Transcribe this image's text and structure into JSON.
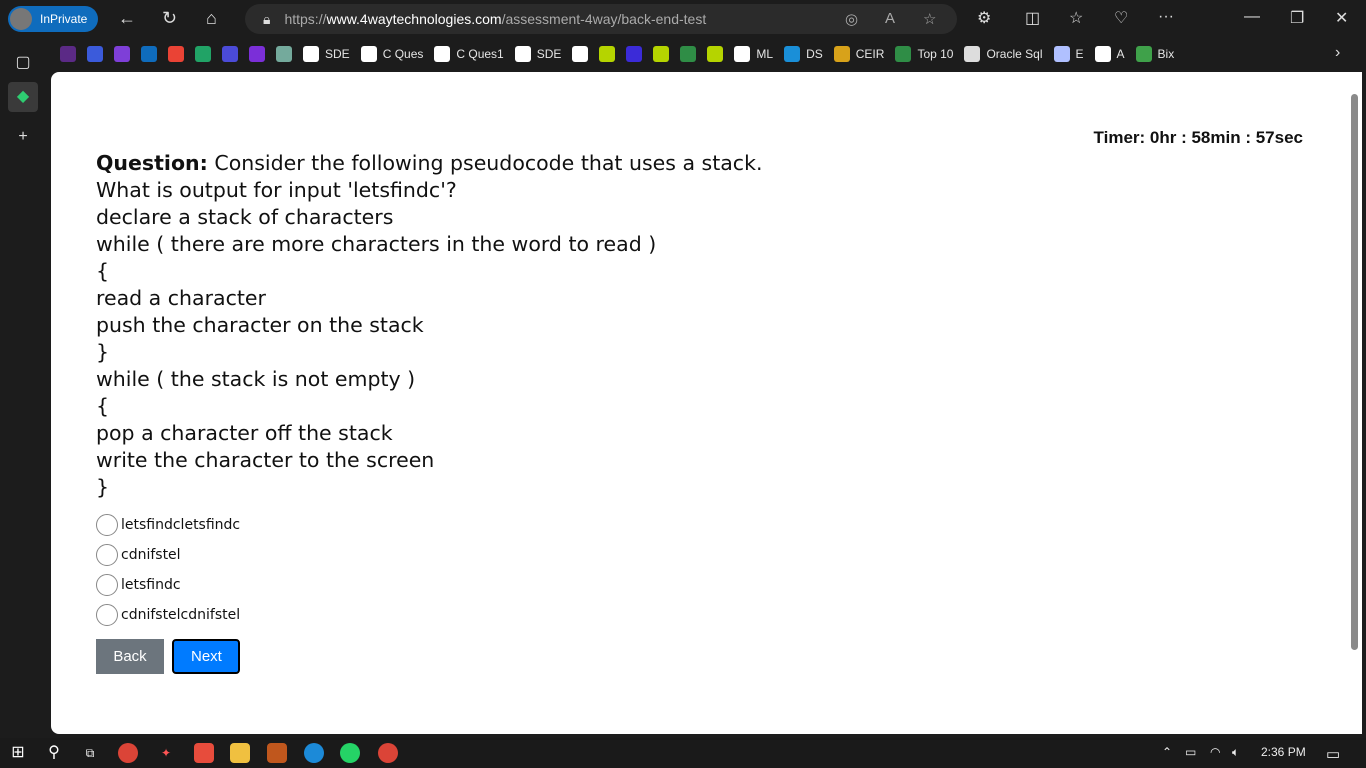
{
  "browser": {
    "profile": "InPrivate",
    "url_scheme": "https://",
    "url_domain": "www.4waytechnologies.com",
    "url_path": "/assessment-4way/back-end-test"
  },
  "bookmarks": [
    {
      "icon": "purple-logo-icon",
      "label": "",
      "color": "#5b2a86"
    },
    {
      "icon": "blue-circle-icon",
      "label": "",
      "color": "#3b5bdb"
    },
    {
      "icon": "to-icon",
      "label": "",
      "color": "#7e3fd8"
    },
    {
      "icon": "outlook-icon",
      "label": "",
      "color": "#0f6cbd"
    },
    {
      "icon": "gmail-icon",
      "label": "",
      "color": "#ea4335"
    },
    {
      "icon": "green-plus-icon",
      "label": "",
      "color": "#21a366"
    },
    {
      "icon": "swirl-icon",
      "label": "",
      "color": "#4b4bd8"
    },
    {
      "icon": "y-icon",
      "label": "",
      "color": "#7b2fd8"
    },
    {
      "icon": "chatgpt-icon",
      "label": "",
      "color": "#74aa9c"
    },
    {
      "icon": "github-icon",
      "label": "SDE",
      "color": "#ffffff"
    },
    {
      "icon": "github-icon",
      "label": "C Ques",
      "color": "#ffffff"
    },
    {
      "icon": "github-icon",
      "label": "C Ques1",
      "color": "#ffffff"
    },
    {
      "icon": "google-icon",
      "label": "SDE",
      "color": "#ffffff"
    },
    {
      "icon": "google-icon",
      "label": "",
      "color": "#ffffff"
    },
    {
      "icon": "snake-icon",
      "label": "",
      "color": "#b5d400"
    },
    {
      "icon": "udemy-icon",
      "label": "",
      "color": "#3b2bd8"
    },
    {
      "icon": "snake-icon",
      "label": "",
      "color": "#b5d400"
    },
    {
      "icon": "gfg-icon",
      "label": "",
      "color": "#2f8d46"
    },
    {
      "icon": "snake-icon",
      "label": "",
      "color": "#b5d400"
    },
    {
      "icon": "google-icon",
      "label": "ML",
      "color": "#ffffff"
    },
    {
      "icon": "k-icon",
      "label": "DS",
      "color": "#1a8fd8"
    },
    {
      "icon": "ceir-icon",
      "label": "CEIR",
      "color": "#d8a21a"
    },
    {
      "icon": "gfg-icon",
      "label": "Top 10",
      "color": "#2f8d46"
    },
    {
      "icon": "page-icon",
      "label": "Oracle Sql",
      "color": "#dddddd"
    },
    {
      "icon": "g-icon",
      "label": "E",
      "color": "#b0c0ff"
    },
    {
      "icon": "google-icon",
      "label": "A",
      "color": "#ffffff"
    },
    {
      "icon": "tree-icon",
      "label": "Bix",
      "color": "#3fa14a"
    }
  ],
  "timer": "Timer: 0hr : 58min : 57sec",
  "question": {
    "label": "Question:",
    "lines": [
      "Consider the following pseudocode that uses a stack.",
      "What is output for input 'letsfindc'?",
      "declare a stack of characters",
      "while ( there are more characters in the word to read )",
      "{",
      "read a character",
      "push the character on the stack",
      "}",
      "while ( the stack is not empty )",
      "{",
      "pop a character off the stack",
      "write the character to the screen",
      "}"
    ]
  },
  "options": [
    "letsfindcletsfindc",
    "cdnifstel",
    "letsfindc",
    "cdnifstelcdnifstel"
  ],
  "buttons": {
    "back": "Back",
    "next": "Next"
  },
  "taskbar": {
    "time": "2:36 PM"
  },
  "colors": {
    "accent": "#007bff",
    "back": "#6c757d",
    "inprivate": "#0f6cbd"
  }
}
